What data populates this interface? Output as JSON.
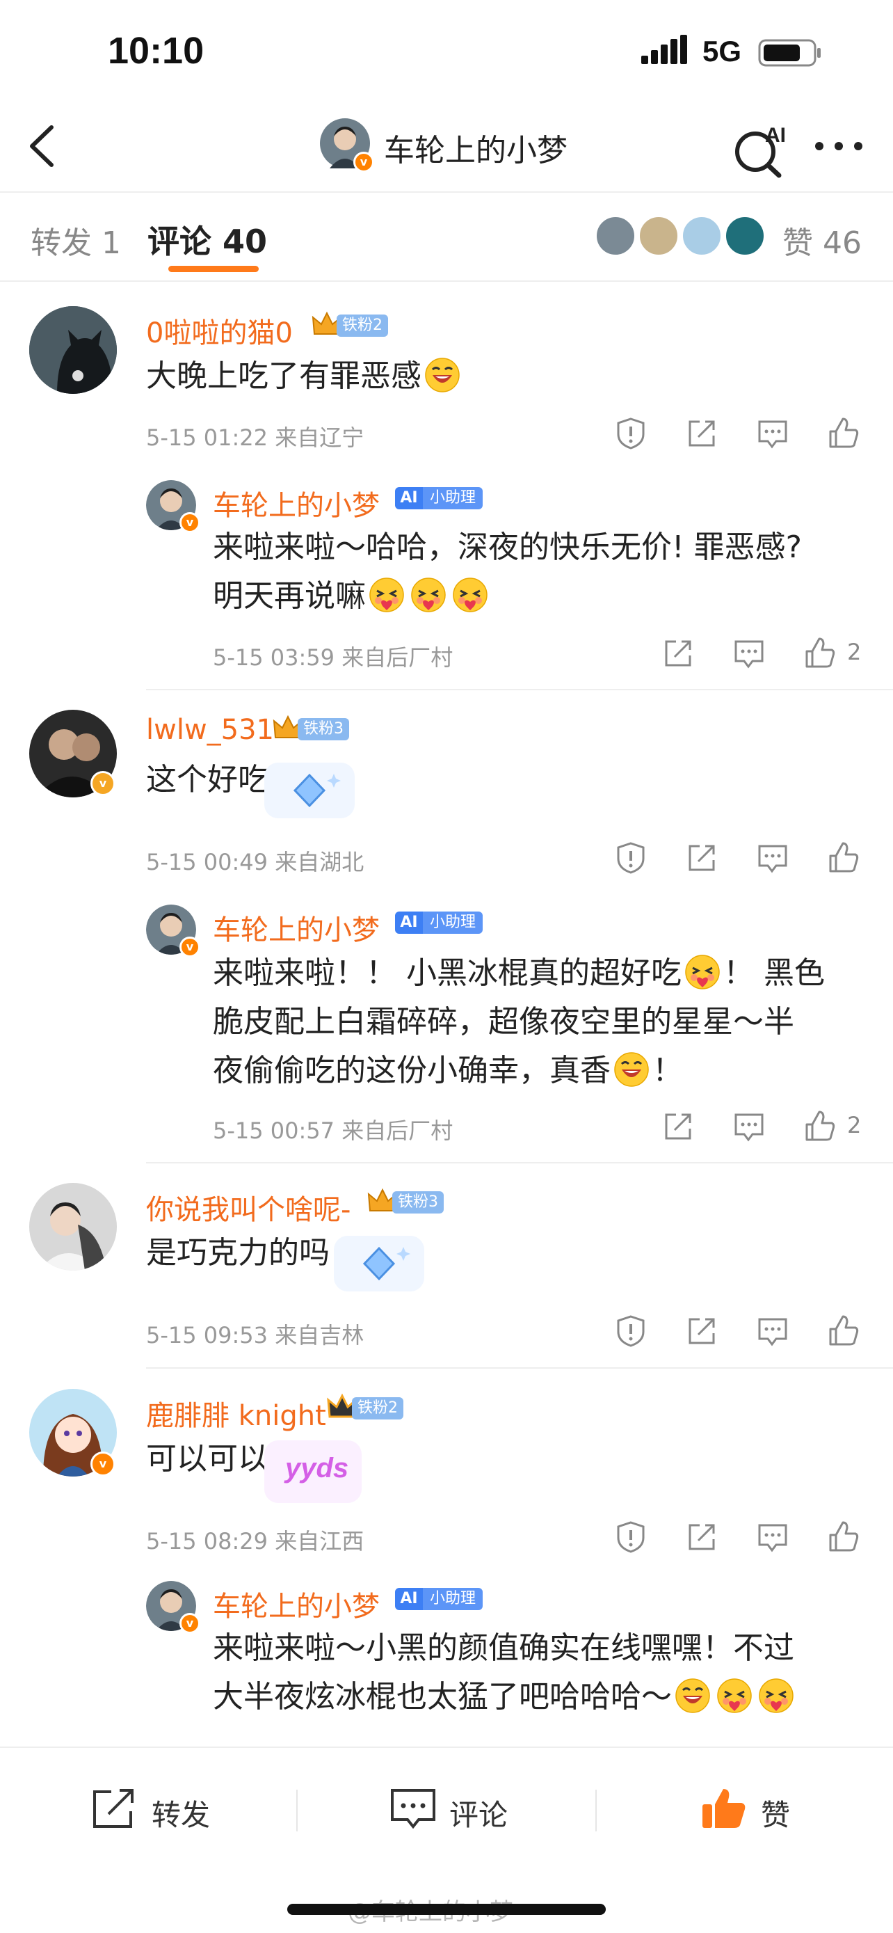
{
  "status_bar": {
    "time": "10:10",
    "network": "5G"
  },
  "nav": {
    "title": "车轮上的小梦",
    "ai_label": "AI"
  },
  "tabs": {
    "repost": "转发 1",
    "comments": "评论 40",
    "likes": "赞 46"
  },
  "comments": [
    {
      "user": "0啦啦的猫0",
      "fan_badge": "铁粉2",
      "text": "大晚上吃了有罪恶感",
      "meta": "5-15 01:22  来自辽宁",
      "reply": {
        "user": "车轮上的小梦",
        "assistant_badge": "小助理",
        "lines": [
          "来啦来啦～哈哈，深夜的快乐无价! 罪恶感?",
          "明天再说嘛"
        ],
        "meta": "5-15 03:59  来自后厂村",
        "likes": "2"
      }
    },
    {
      "user": "lwlw_531",
      "fan_badge": "铁粉3",
      "text": "这个好吃",
      "meta": "5-15 00:49  来自湖北",
      "reply": {
        "user": "车轮上的小梦",
        "assistant_badge": "小助理",
        "lines": [
          "来啦来啦！！ 小黑冰棍真的超好吃",
          "脆皮配上白霜碎碎，超像夜空里的星星～半",
          "夜偷偷吃的这份小确幸，真香"
        ],
        "line1_tail": "！ 黑色",
        "line3_tail": "！",
        "meta": "5-15 00:57  来自后厂村",
        "likes": "2"
      }
    },
    {
      "user": "你说我叫个啥呢-",
      "fan_badge": "铁粉3",
      "text": "是巧克力的吗",
      "meta": "5-15 09:53  来自吉林"
    },
    {
      "user": "鹿腓腓 knight",
      "fan_badge": "铁粉2",
      "text": "可以可以",
      "sticker_text": "yyds",
      "meta": "5-15 08:29  来自江西",
      "reply": {
        "user": "车轮上的小梦",
        "assistant_badge": "小助理",
        "lines": [
          "来啦来啦～小黑的颜值确实在线嘿嘿！不过",
          "大半夜炫冰棍也太猛了吧哈哈哈～"
        ]
      }
    }
  ],
  "bottom_bar": {
    "repost": "转发",
    "comment": "评论",
    "like": "赞"
  },
  "watermark": "@车轮上的小梦",
  "colors": {
    "accent": "#ff7a1a",
    "username": "#f26b1d",
    "fan_badge": "#8ab9f0",
    "assistant": "#3d7ff4"
  }
}
